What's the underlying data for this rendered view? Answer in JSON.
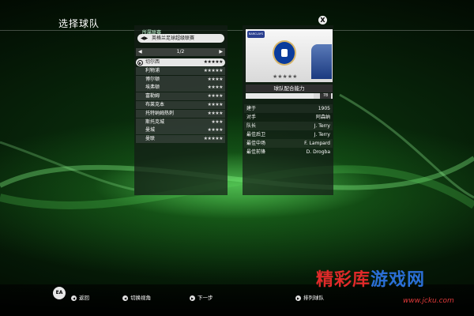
{
  "header": {
    "title": "选择球队",
    "close_label": "X"
  },
  "league": {
    "label": "所属联赛",
    "selected": "英格兰足球超级联赛"
  },
  "pager": {
    "text": "1/2",
    "prev": "◀",
    "next": "▶"
  },
  "teams": [
    {
      "name": "切尔西",
      "stars": "★★★★★",
      "selected": true
    },
    {
      "name": "利物浦",
      "stars": "★★★★★"
    },
    {
      "name": "博尔顿",
      "stars": "★★★★"
    },
    {
      "name": "埃弗顿",
      "stars": "★★★★"
    },
    {
      "name": "富勒姆",
      "stars": "★★★★"
    },
    {
      "name": "布莱克本",
      "stars": "★★★★"
    },
    {
      "name": "托特纳姆热刺",
      "stars": "★★★★"
    },
    {
      "name": "斯托克城",
      "stars": "★★★"
    },
    {
      "name": "曼城",
      "stars": "★★★★"
    },
    {
      "name": "曼联",
      "stars": "★★★★★"
    }
  ],
  "team_card": {
    "badge_text": "BARCLAYS",
    "stars": "★★★★★",
    "chemistry_label": "球队配合能力",
    "chemistry_value": 78,
    "chemistry_value_text": "78"
  },
  "info": [
    {
      "key": "建于",
      "value": "1905"
    },
    {
      "key": "对手",
      "value": "阿森纳"
    },
    {
      "key": "队长",
      "value": "J. Terry"
    },
    {
      "key": "最佳后卫",
      "value": "J. Terry"
    },
    {
      "key": "最佳中场",
      "value": "F. Lampard"
    },
    {
      "key": "最佳前锋",
      "value": "D. Drogba"
    }
  ],
  "footer": {
    "ea_logo": "EA",
    "hints": [
      {
        "icon": "◀",
        "label": "返回"
      },
      {
        "icon": "◀",
        "label": "切换视角"
      },
      {
        "icon": "▶",
        "label": "下一步"
      },
      {
        "icon": "▶",
        "label": "排列球队"
      }
    ]
  },
  "watermark": {
    "part1": "精彩库",
    "part2": "游戏网",
    "url": "www.jcku.com"
  },
  "colors": {
    "accent_green": "#1f8a2a",
    "panel": "#1a221c",
    "watermark_red": "#e02a2a",
    "watermark_blue": "#2b6fd6"
  }
}
